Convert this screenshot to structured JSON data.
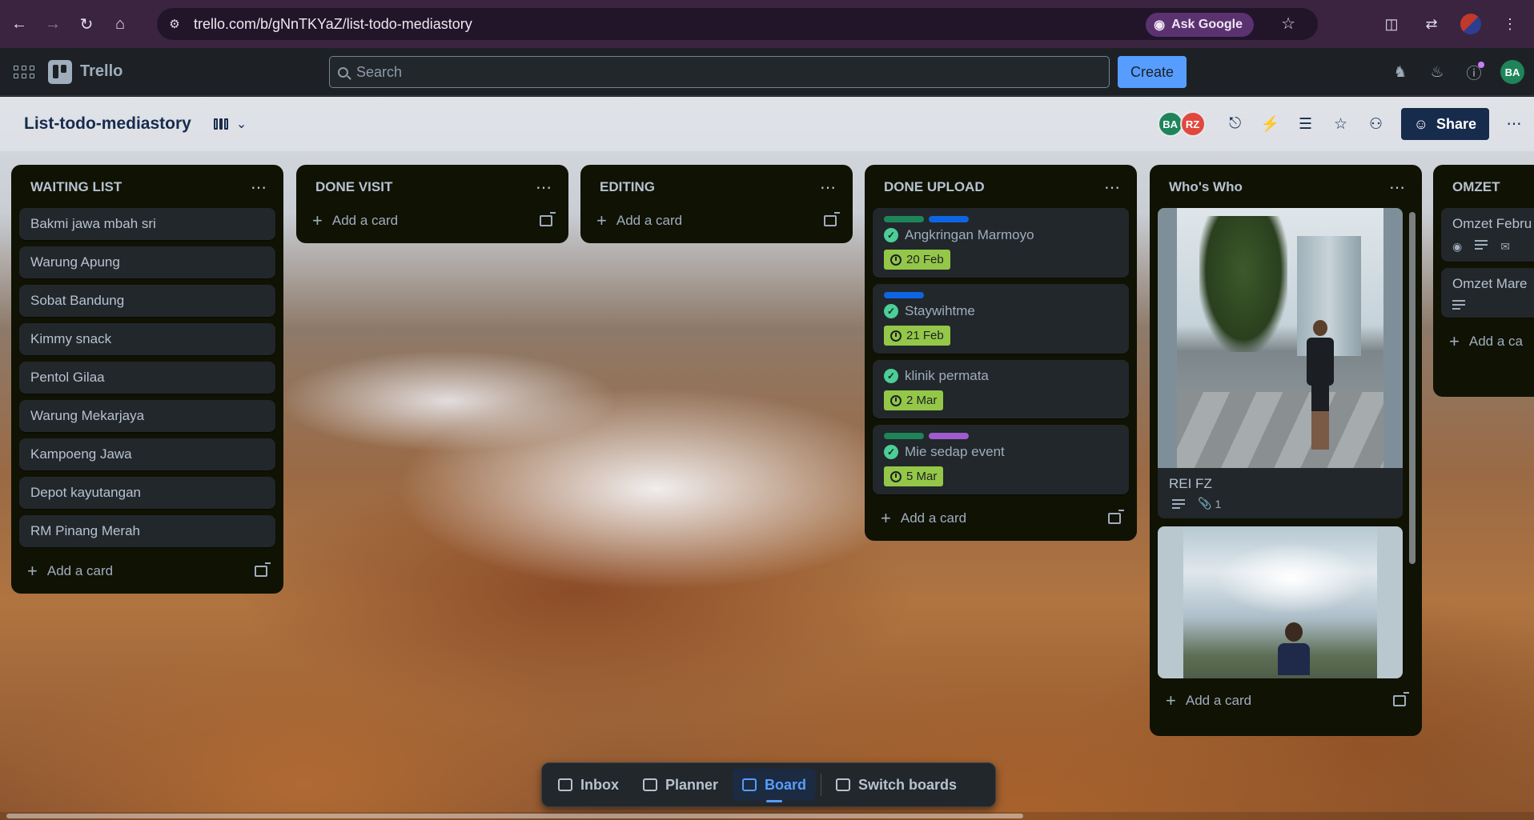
{
  "browser": {
    "url": "trello.com/b/gNnTKYaZ/list-todo-mediastory",
    "ask_google": "Ask Google"
  },
  "header": {
    "logo": "Trello",
    "search_placeholder": "Search",
    "create_label": "Create",
    "user_initials": "BA"
  },
  "board": {
    "title": "List-todo-mediastory",
    "members": [
      {
        "initials": "BA",
        "color": "#1f845a"
      },
      {
        "initials": "RZ",
        "color": "#e2483d"
      }
    ],
    "share_label": "Share"
  },
  "lists": {
    "waiting": {
      "title": "WAITING LIST",
      "cards": [
        "Bakmi jawa mbah sri",
        "Warung Apung",
        "Sobat Bandung",
        "Kimmy snack",
        "Pentol Gilaa",
        "Warung Mekarjaya",
        "Kampoeng Jawa",
        "Depot kayutangan",
        "RM Pinang Merah"
      ],
      "add_label": "Add a card"
    },
    "done_visit": {
      "title": "DONE VISIT",
      "add_label": "Add a card"
    },
    "editing": {
      "title": "EDITING",
      "add_label": "Add a card"
    },
    "done_upload": {
      "title": "DONE UPLOAD",
      "cards": [
        {
          "title": "Angkringan Marmoyo",
          "date": "20 Feb",
          "labels": [
            "#1f845a",
            "#0c66e4"
          ]
        },
        {
          "title": "Staywihtme",
          "date": "21 Feb",
          "labels": [
            "#0c66e4"
          ]
        },
        {
          "title": "klinik permata",
          "date": "2 Mar",
          "labels": []
        },
        {
          "title": "Mie sedap event",
          "date": "5 Mar",
          "labels": [
            "#1f845a",
            "#9f5ccf"
          ]
        }
      ],
      "add_label": "Add a card"
    },
    "whos_who": {
      "title": "Who's Who",
      "cards": [
        {
          "title": "REI FZ",
          "attachments": "1"
        }
      ],
      "add_label": "Add a card"
    },
    "omzet": {
      "title": "OMZET",
      "cards": [
        "Omzet Febru",
        "Omzet Mare"
      ],
      "add_label": "Add a ca"
    }
  },
  "switcher": {
    "inbox": "Inbox",
    "planner": "Planner",
    "board": "Board",
    "switch_boards": "Switch boards"
  }
}
